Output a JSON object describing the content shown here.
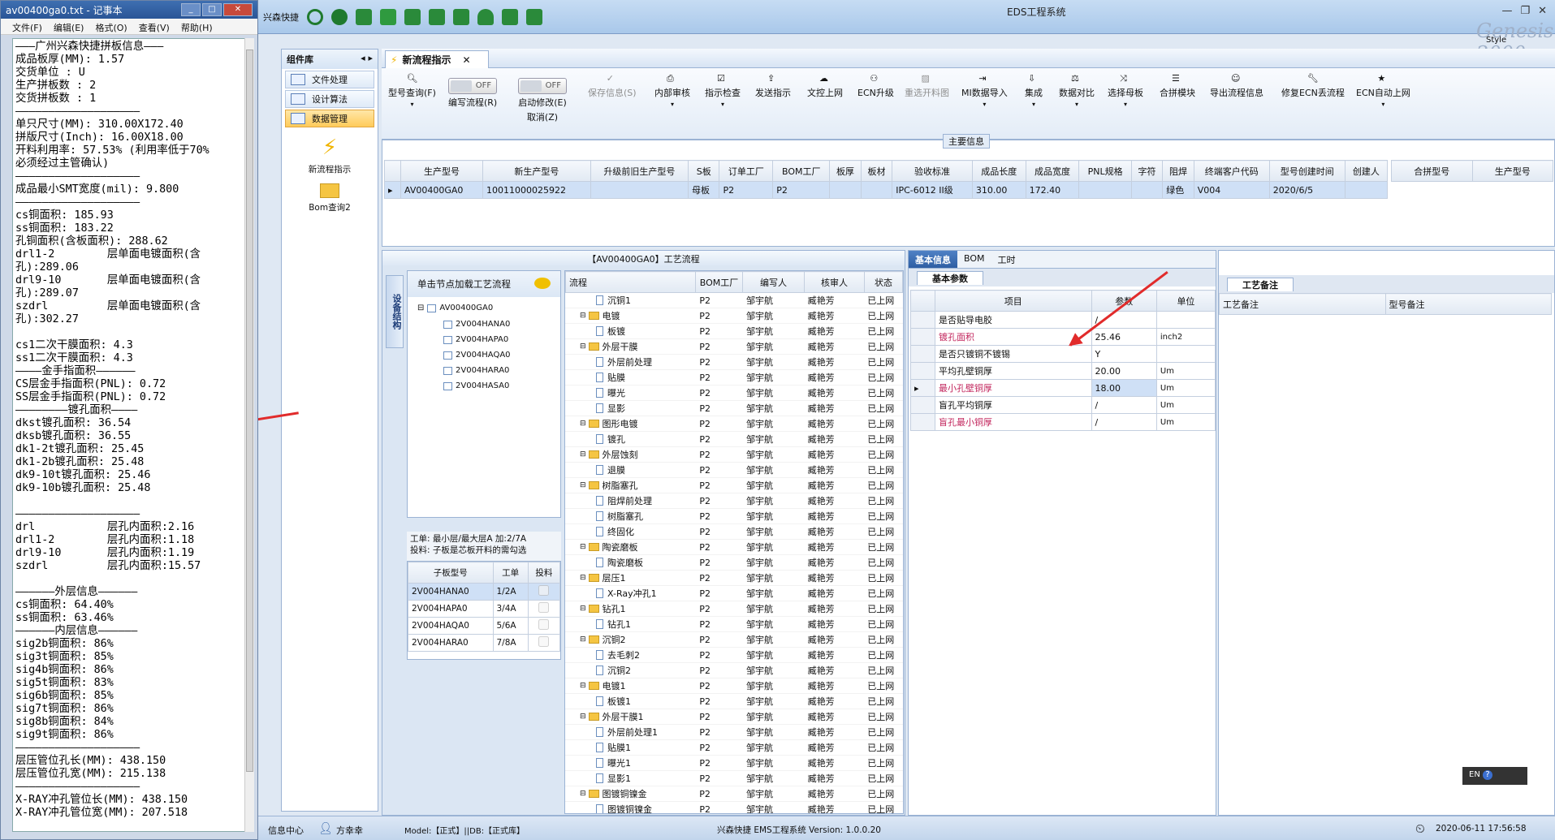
{
  "notepad": {
    "title": "av00400ga0.txt - 记事本",
    "menu": [
      "文件(F)",
      "编辑(E)",
      "格式(O)",
      "查看(V)",
      "帮助(H)"
    ],
    "content": "———广州兴森快捷拼板信息———\n成品板厚(MM): 1.57\n交货单位 : U\n生产拼板数 : 2\n交货拼板数 : 1\n———————————————————\n单只尺寸(MM): 310.00X172.40\n拼版尺寸(Inch): 16.00X18.00\n开料利用率: 57.53% (利用率低于70%\n必须经过主管确认)\n———————————————————\n成品最小SMT宽度(mil): 9.800\n———————————————————\ncs铜面积: 185.93\nss铜面积: 183.22\n孔铜面积(含板面积): 288.62\ndrl1-2        层单面电镀面积(含\n孔):289.06\ndrl9-10       层单面电镀面积(含\n孔):289.07\nszdrl         层单面电镀面积(含\n孔):302.27\n\ncs1二次干膜面积: 4.3\nss1二次干膜面积: 4.3\n————金手指面积——————\nCS层金手指面积(PNL): 0.72\nSS层金手指面积(PNL): 0.72\n————————镀孔面积————\ndkst镀孔面积: 36.54\ndksb镀孔面积: 36.55\ndk1-2t镀孔面积: 25.45\ndk1-2b镀孔面积: 25.48\ndk9-10t镀孔面积: 25.46\ndk9-10b镀孔面积: 25.48\n\n———————————————————\ndrl           层孔内面积:2.16\ndrl1-2        层孔内面积:1.18\ndrl9-10       层孔内面积:1.19\nszdrl         层孔内面积:15.57\n\n——————外层信息——————\ncs铜面积: 64.40%\nss铜面积: 63.46%\n——————内层信息——————\nsig2b铜面积: 86%\nsig3t铜面积: 85%\nsig4b铜面积: 86%\nsig5t铜面积: 83%\nsig6b铜面积: 85%\nsig7t铜面积: 86%\nsig8b铜面积: 84%\nsig9t铜面积: 86%\n———————————————————\n层压管位孔长(MM): 438.150\n层压管位孔宽(MM): 215.138\n———————————————————\nX-RAY冲孔管位长(MM): 438.150\nX-RAY冲孔管位宽(MM): 207.518"
  },
  "app": {
    "title": "EDS工程系统",
    "brand_label": "兴森快捷",
    "watermark": "Genesis 2000",
    "style_label": "Style"
  },
  "components": {
    "header": "组件库",
    "items": [
      "文件处理",
      "设计算法",
      "数据管理"
    ],
    "big_buttons": [
      "新流程指示",
      "Bom查询2"
    ]
  },
  "tab": {
    "label": "新流程指示"
  },
  "ribbon": {
    "buttons": [
      {
        "label": "型号查询(F)",
        "disabled": false
      },
      {
        "label": "编写流程(R)",
        "disabled": false
      },
      {
        "label": "启动修改(E)",
        "disabled": false
      },
      {
        "label": "取消(Z)",
        "disabled": false
      },
      {
        "label": "保存信息(S)",
        "disabled": true
      },
      {
        "label": "内部审核",
        "disabled": false
      },
      {
        "label": "指示检查",
        "disabled": false
      },
      {
        "label": "发送指示",
        "disabled": false
      },
      {
        "label": "文控上网",
        "disabled": false
      },
      {
        "label": "ECN升级",
        "disabled": false
      },
      {
        "label": "重选开料图",
        "disabled": true
      },
      {
        "label": "MI数据导入",
        "disabled": false
      },
      {
        "label": "集成",
        "disabled": false
      },
      {
        "label": "数据对比",
        "disabled": false
      },
      {
        "label": "选择母板",
        "disabled": false
      },
      {
        "label": "合拼模块",
        "disabled": false
      },
      {
        "label": "导出流程信息",
        "disabled": false
      },
      {
        "label": "修复ECN丢流程",
        "disabled": false
      },
      {
        "label": "ECN自动上网",
        "disabled": false
      }
    ],
    "toggle_off": "OFF"
  },
  "main_info": {
    "label": "主要信息",
    "columns": [
      "生产型号",
      "新生产型号",
      "升级前旧生产型号",
      "S板",
      "订单工厂",
      "BOM工厂",
      "板厚",
      "板材",
      "验收标准",
      "成品长度",
      "成品宽度",
      "PNL规格",
      "字符",
      "阻焊",
      "终端客户代码",
      "型号创建时间",
      "创建人"
    ],
    "row": [
      "AV00400GA0",
      "10011000025922",
      "",
      "母板",
      "P2",
      "P2",
      "",
      "",
      "IPC-6012 II级",
      "310.00",
      "172.40",
      "",
      "",
      "绿色",
      "V004",
      "2020/6/5",
      ""
    ],
    "side_columns": [
      "合拼型号",
      "生产型号"
    ]
  },
  "workflow": {
    "caption": "【AV00400GA0】工艺流程",
    "vtab": "设备结构",
    "hint": "单击节点加载工艺流程",
    "tree_root": "AV00400GA0",
    "tree_children": [
      "2V004HANA0",
      "2V004HAPA0",
      "2V004HAQA0",
      "2V004HARA0",
      "2V004HASA0"
    ],
    "note_line1": "工单: 最小层/最大层A 加:2/7A",
    "note_line2": "投料: 子板是芯板开料的需勾选",
    "sub_columns": [
      "子板型号",
      "工单",
      "投料"
    ],
    "sub_rows": [
      [
        "2V004HANA0",
        "1/2A"
      ],
      [
        "2V004HAPA0",
        "3/4A"
      ],
      [
        "2V004HAQA0",
        "5/6A"
      ],
      [
        "2V004HARA0",
        "7/8A"
      ]
    ],
    "flow_columns": [
      "流程",
      "BOM工厂",
      "编写人",
      "核审人",
      "状态"
    ],
    "flow_rows": [
      {
        "name": "沉铜1",
        "level": 2,
        "folder": false
      },
      {
        "name": "电镀",
        "level": 1,
        "folder": true
      },
      {
        "name": "板镀",
        "level": 2,
        "folder": false
      },
      {
        "name": "外层干膜",
        "level": 1,
        "folder": true
      },
      {
        "name": "外层前处理",
        "level": 2,
        "folder": false
      },
      {
        "name": "贴膜",
        "level": 2,
        "folder": false
      },
      {
        "name": "曝光",
        "level": 2,
        "folder": false
      },
      {
        "name": "显影",
        "level": 2,
        "folder": false
      },
      {
        "name": "图形电镀",
        "level": 1,
        "folder": true
      },
      {
        "name": "镀孔",
        "level": 2,
        "folder": false
      },
      {
        "name": "外层蚀刻",
        "level": 1,
        "folder": true
      },
      {
        "name": "退膜",
        "level": 2,
        "folder": false
      },
      {
        "name": "树脂塞孔",
        "level": 1,
        "folder": true
      },
      {
        "name": "阻焊前处理",
        "level": 2,
        "folder": false
      },
      {
        "name": "树脂塞孔",
        "level": 2,
        "folder": false
      },
      {
        "name": "终固化",
        "level": 2,
        "folder": false
      },
      {
        "name": "陶瓷磨板",
        "level": 1,
        "folder": true
      },
      {
        "name": "陶瓷磨板",
        "level": 2,
        "folder": false
      },
      {
        "name": "层压1",
        "level": 1,
        "folder": true
      },
      {
        "name": "X-Ray冲孔1",
        "level": 2,
        "folder": false
      },
      {
        "name": "钻孔1",
        "level": 1,
        "folder": true
      },
      {
        "name": "钻孔1",
        "level": 2,
        "folder": false
      },
      {
        "name": "沉铜2",
        "level": 1,
        "folder": true
      },
      {
        "name": "去毛刺2",
        "level": 2,
        "folder": false
      },
      {
        "name": "沉铜2",
        "level": 2,
        "folder": false
      },
      {
        "name": "电镀1",
        "level": 1,
        "folder": true
      },
      {
        "name": "板镀1",
        "level": 2,
        "folder": false
      },
      {
        "name": "外层干膜1",
        "level": 1,
        "folder": true
      },
      {
        "name": "外层前处理1",
        "level": 2,
        "folder": false
      },
      {
        "name": "贴膜1",
        "level": 2,
        "folder": false
      },
      {
        "name": "曝光1",
        "level": 2,
        "folder": false
      },
      {
        "name": "显影1",
        "level": 2,
        "folder": false
      },
      {
        "name": "图镀铜镍金",
        "level": 1,
        "folder": true
      },
      {
        "name": "图镀铜镍金",
        "level": 2,
        "folder": false
      }
    ],
    "flow_factory": "P2",
    "flow_writer": "邹宇航",
    "flow_checker": "臧艳芳",
    "flow_status": "已上网"
  },
  "basic": {
    "tabs": [
      "基本信息",
      "BOM",
      "工时"
    ],
    "section": "基本参数",
    "columns": [
      "项目",
      "参数",
      "单位"
    ],
    "rows": [
      {
        "item": "是否贴导电胶",
        "value": "/",
        "unit": "",
        "pink": false
      },
      {
        "item": "镀孔面积",
        "value": "25.46",
        "unit": "inch2",
        "pink": true
      },
      {
        "item": "是否只镀铜不镀锡",
        "value": "Y",
        "unit": "",
        "pink": false
      },
      {
        "item": "平均孔壁铜厚",
        "value": "20.00",
        "unit": "Um",
        "pink": false
      },
      {
        "item": "最小孔壁铜厚",
        "value": "18.00",
        "unit": "Um",
        "pink": true
      },
      {
        "item": "盲孔平均铜厚",
        "value": "/",
        "unit": "Um",
        "pink": false
      },
      {
        "item": "盲孔最小铜厚",
        "value": "/",
        "unit": "Um",
        "pink": true
      }
    ]
  },
  "memo": {
    "section": "工艺备注",
    "col1": "工艺备注",
    "col2": "型号备注"
  },
  "status": {
    "info_center": "信息中心",
    "user": "方幸幸",
    "model": "Model:【正式】||DB:【正式库】",
    "version": "兴森快捷 EMS工程系统 Version: 1.0.0.20",
    "datetime": "2020-06-11 17:56:58",
    "ime": "EN"
  },
  "colors": {
    "accent": "#2e5ea3",
    "selected": "#cfe0f6",
    "arrow": "#e12b2b",
    "pink": "#c2255c"
  }
}
